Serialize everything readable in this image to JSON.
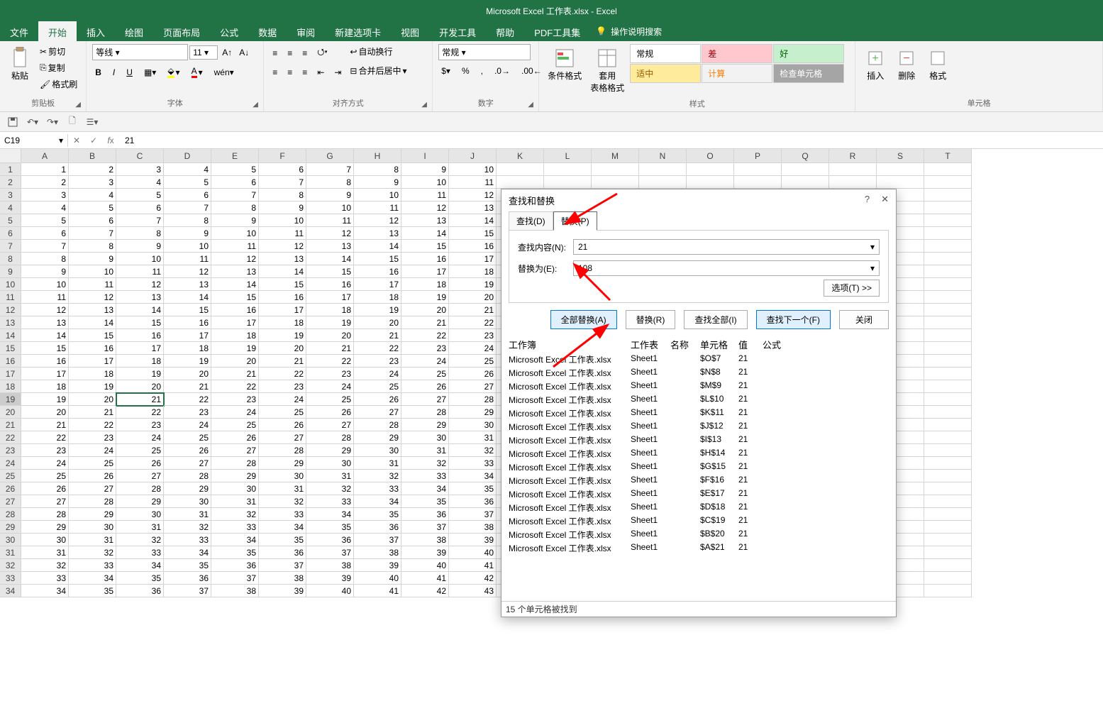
{
  "app": {
    "title": "Microsoft Excel 工作表.xlsx  -  Excel"
  },
  "menu": {
    "tabs": [
      "文件",
      "开始",
      "插入",
      "绘图",
      "页面布局",
      "公式",
      "数据",
      "审阅",
      "新建选项卡",
      "视图",
      "开发工具",
      "帮助",
      "PDF工具集"
    ],
    "active": 1,
    "tell_me": "操作说明搜索"
  },
  "ribbon": {
    "clipboard": {
      "label": "剪贴板",
      "paste": "粘贴",
      "cut": "剪切",
      "copy": "复制",
      "painter": "格式刷"
    },
    "font": {
      "label": "字体",
      "name": "等线",
      "size": "11",
      "bold": "B",
      "italic": "I",
      "underline": "U"
    },
    "align": {
      "label": "对齐方式",
      "wrap": "自动换行",
      "merge": "合并后居中"
    },
    "number": {
      "label": "数字",
      "format": "常规"
    },
    "styles": {
      "label": "样式",
      "cond": "条件格式",
      "table": "套用\n表格格式",
      "s_normal": "常规",
      "s_bad": "差",
      "s_good": "好",
      "s_medium": "适中",
      "s_calc": "计算",
      "s_check": "检查单元格"
    },
    "cells": {
      "label": "单元格",
      "insert": "插入",
      "delete": "删除",
      "format": "格式"
    }
  },
  "formula_bar": {
    "name_box": "C19",
    "value": "21"
  },
  "columns": [
    "A",
    "B",
    "C",
    "D",
    "E",
    "F",
    "G",
    "H",
    "I",
    "J",
    "K",
    "L",
    "M",
    "N",
    "O",
    "P",
    "Q",
    "R",
    "S",
    "T"
  ],
  "rows_count": 34,
  "active_cell": {
    "row": 19,
    "col": 3
  },
  "grid": {
    "cols_visible": 10,
    "start": 1
  },
  "dialog": {
    "title": "查找和替换",
    "tab_find": "查找(D)",
    "tab_replace": "替换(P)",
    "find_label": "查找内容(N):",
    "replace_label": "替换为(E):",
    "find_value": "21",
    "replace_value": "108",
    "options_btn": "选项(T) >>",
    "btn_replace_all": "全部替换(A)",
    "btn_replace": "替换(R)",
    "btn_find_all": "查找全部(I)",
    "btn_find_next": "查找下一个(F)",
    "btn_close": "关闭",
    "hdr_book": "工作簿",
    "hdr_sheet": "工作表",
    "hdr_name": "名称",
    "hdr_cell": "单元格",
    "hdr_value": "值",
    "hdr_formula": "公式",
    "results": [
      {
        "book": "Microsoft Excel 工作表.xlsx",
        "sheet": "Sheet1",
        "cell": "$O$7",
        "val": "21"
      },
      {
        "book": "Microsoft Excel 工作表.xlsx",
        "sheet": "Sheet1",
        "cell": "$N$8",
        "val": "21"
      },
      {
        "book": "Microsoft Excel 工作表.xlsx",
        "sheet": "Sheet1",
        "cell": "$M$9",
        "val": "21"
      },
      {
        "book": "Microsoft Excel 工作表.xlsx",
        "sheet": "Sheet1",
        "cell": "$L$10",
        "val": "21"
      },
      {
        "book": "Microsoft Excel 工作表.xlsx",
        "sheet": "Sheet1",
        "cell": "$K$11",
        "val": "21"
      },
      {
        "book": "Microsoft Excel 工作表.xlsx",
        "sheet": "Sheet1",
        "cell": "$J$12",
        "val": "21"
      },
      {
        "book": "Microsoft Excel 工作表.xlsx",
        "sheet": "Sheet1",
        "cell": "$I$13",
        "val": "21"
      },
      {
        "book": "Microsoft Excel 工作表.xlsx",
        "sheet": "Sheet1",
        "cell": "$H$14",
        "val": "21"
      },
      {
        "book": "Microsoft Excel 工作表.xlsx",
        "sheet": "Sheet1",
        "cell": "$G$15",
        "val": "21"
      },
      {
        "book": "Microsoft Excel 工作表.xlsx",
        "sheet": "Sheet1",
        "cell": "$F$16",
        "val": "21"
      },
      {
        "book": "Microsoft Excel 工作表.xlsx",
        "sheet": "Sheet1",
        "cell": "$E$17",
        "val": "21"
      },
      {
        "book": "Microsoft Excel 工作表.xlsx",
        "sheet": "Sheet1",
        "cell": "$D$18",
        "val": "21"
      },
      {
        "book": "Microsoft Excel 工作表.xlsx",
        "sheet": "Sheet1",
        "cell": "$C$19",
        "val": "21"
      },
      {
        "book": "Microsoft Excel 工作表.xlsx",
        "sheet": "Sheet1",
        "cell": "$B$20",
        "val": "21"
      },
      {
        "book": "Microsoft Excel 工作表.xlsx",
        "sheet": "Sheet1",
        "cell": "$A$21",
        "val": "21"
      }
    ],
    "status": "15 个单元格被找到"
  }
}
